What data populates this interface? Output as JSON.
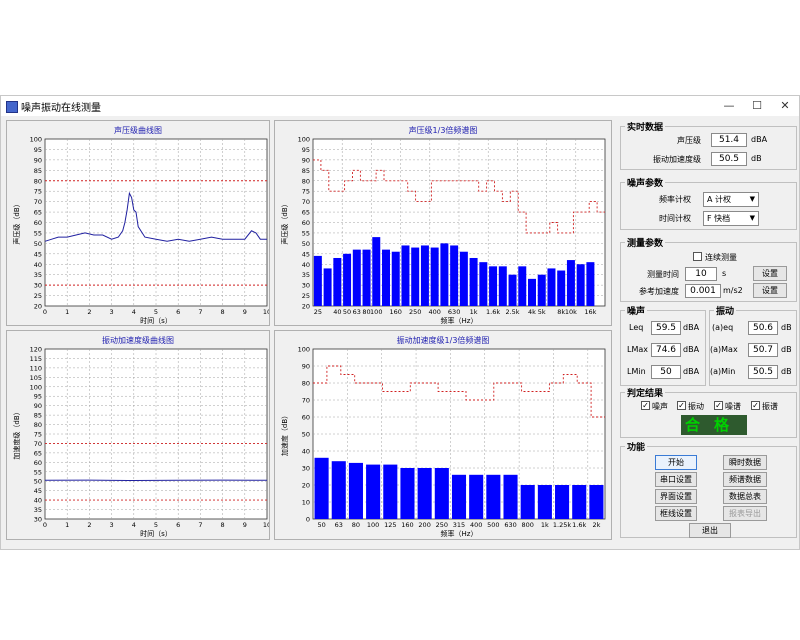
{
  "window": {
    "title": "噪声振动在线测量",
    "icon": "app-icon",
    "min": "—",
    "max": "☐",
    "close": "✕"
  },
  "charts": {
    "spl_curve": {
      "title": "声压级曲线图",
      "ylabel": "声压级（dB）",
      "xlabel": "时间（s）"
    },
    "spl_spectrum": {
      "title": "声压级1/3倍频谱图",
      "ylabel": "声压级（dB）",
      "xlabel": "频率（Hz）"
    },
    "acc_curve": {
      "title": "振动加速度级曲线图",
      "ylabel": "加速度级（dB）",
      "xlabel": "时间（s）"
    },
    "acc_spectrum": {
      "title": "振动加速度级1/3倍频谱图",
      "ylabel": "加速度（dB）",
      "xlabel": "频率（Hz）"
    }
  },
  "chart_data": [
    {
      "type": "line",
      "title": "声压级曲线图",
      "xlabel": "时间（s）",
      "ylabel": "声压级（dB）",
      "xlim": [
        0,
        10
      ],
      "ylim": [
        20,
        100
      ],
      "x_ticks": [
        0,
        1,
        2,
        3,
        4,
        5,
        6,
        7,
        8,
        9,
        10
      ],
      "y_ticks": [
        20,
        25,
        30,
        35,
        40,
        45,
        50,
        55,
        60,
        65,
        70,
        75,
        80,
        85,
        90,
        95,
        100
      ],
      "grid": true,
      "series": [
        {
          "color": "#2020a0",
          "x": [
            0,
            0.3,
            0.6,
            1,
            1.4,
            1.8,
            2.2,
            2.6,
            3,
            3.3,
            3.5,
            3.6,
            3.7,
            3.8,
            3.9,
            4.0,
            4.1,
            4.2,
            4.5,
            5,
            5.5,
            6,
            6.5,
            7,
            7.5,
            8,
            8.5,
            9,
            9.3,
            9.5,
            9.7,
            10
          ],
          "y": [
            51,
            52,
            53,
            53,
            54,
            55,
            54,
            54,
            52,
            53,
            56,
            60,
            66,
            74,
            72,
            66,
            65,
            58,
            53,
            52,
            51,
            52,
            51,
            52,
            53,
            52,
            52,
            52,
            56,
            55,
            52,
            52
          ]
        }
      ],
      "reference_lines": [
        {
          "y": 80,
          "color": "#d02020"
        },
        {
          "y": 30,
          "color": "#d02020"
        }
      ]
    },
    {
      "type": "bar",
      "title": "声压级1/3倍频谱图",
      "xlabel": "频率（Hz）",
      "ylabel": "声压级（dB）",
      "ylim": [
        20,
        100
      ],
      "y_ticks": [
        20,
        25,
        30,
        35,
        40,
        45,
        50,
        55,
        60,
        65,
        70,
        75,
        80,
        85,
        90,
        95,
        100
      ],
      "grid": true,
      "categories": [
        "25",
        "31.5",
        "40",
        "50",
        "63",
        "80",
        "100",
        "125",
        "160",
        "200",
        "250",
        "315",
        "400",
        "500",
        "630",
        "800",
        "1k",
        "1.25k",
        "1.6k",
        "2k",
        "2.5k",
        "3.15k",
        "4k",
        "5k",
        "6.3k",
        "8k",
        "10k",
        "12.5k",
        "16k",
        "20k"
      ],
      "tick_labels": [
        "25",
        "40",
        "50",
        "63",
        "80",
        "100",
        "160",
        "250",
        "400",
        "630",
        "1k",
        "1.6k",
        "2.5k",
        "4k",
        "5k",
        "8k",
        "10k",
        "16k"
      ],
      "values": [
        44,
        38,
        43,
        45,
        47,
        47,
        53,
        47,
        46,
        49,
        48,
        49,
        48,
        50,
        49,
        46,
        43,
        41,
        39,
        39,
        35,
        39,
        33,
        35,
        38,
        37,
        42,
        40,
        41
      ],
      "limit": {
        "color": "#d02020",
        "values": [
          90,
          85,
          75,
          75,
          80,
          85,
          80,
          80,
          85,
          80,
          80,
          80,
          75,
          70,
          70,
          80,
          80,
          80,
          80,
          80,
          80,
          75,
          80,
          75,
          70,
          75,
          65,
          55,
          55,
          55,
          60,
          55,
          55,
          65,
          65,
          70,
          65
        ]
      }
    },
    {
      "type": "line",
      "title": "振动加速度级曲线图",
      "xlabel": "时间（s）",
      "ylabel": "加速度级（dB）",
      "xlim": [
        0,
        10
      ],
      "ylim": [
        30,
        120
      ],
      "x_ticks": [
        0,
        1,
        2,
        3,
        4,
        5,
        6,
        7,
        8,
        9,
        10
      ],
      "y_ticks": [
        30,
        35,
        40,
        45,
        50,
        55,
        60,
        65,
        70,
        75,
        80,
        85,
        90,
        95,
        100,
        105,
        110,
        115,
        120
      ],
      "grid": true,
      "series": [
        {
          "color": "#2020a0",
          "x": [
            0,
            2,
            4,
            6,
            8,
            10
          ],
          "y": [
            50.5,
            50.6,
            50.4,
            50.5,
            50.6,
            50.5
          ]
        }
      ],
      "reference_lines": [
        {
          "y": 70,
          "color": "#d02020"
        },
        {
          "y": 40,
          "color": "#d02020"
        }
      ]
    },
    {
      "type": "bar",
      "title": "振动加速度级1/3倍频谱图",
      "xlabel": "频率（Hz）",
      "ylabel": "加速度（dB）",
      "ylim": [
        0,
        100
      ],
      "y_ticks": [
        0,
        10,
        20,
        30,
        40,
        50,
        60,
        70,
        80,
        90,
        100
      ],
      "grid": true,
      "categories": [
        "50",
        "63",
        "80",
        "100",
        "125",
        "160",
        "200",
        "250",
        "315",
        "400",
        "500",
        "630",
        "800",
        "1k",
        "1.25k",
        "1.6k",
        "2k"
      ],
      "values": [
        36,
        34,
        33,
        32,
        32,
        30,
        30,
        30,
        26,
        26,
        26,
        26,
        20,
        20,
        20,
        20,
        20
      ],
      "limit": {
        "color": "#d02020",
        "values": [
          80,
          90,
          85,
          80,
          80,
          75,
          75,
          80,
          80,
          75,
          75,
          70,
          70,
          80,
          80,
          75,
          75,
          80,
          85,
          80,
          60
        ]
      }
    }
  ],
  "realtime": {
    "title": "实时数据",
    "spl_label": "声压级",
    "spl_value": "51.4",
    "spl_unit": "dBA",
    "acc_label": "振动加速度级",
    "acc_value": "50.5",
    "acc_unit": "dB"
  },
  "noise_params": {
    "title": "噪声参数",
    "freq_label": "频率计权",
    "freq_value": "A 计权",
    "time_label": "时间计权",
    "time_value": "F 快档"
  },
  "measure_params": {
    "title": "测量参数",
    "continuous_label": "连续测量",
    "time_label": "测量时间",
    "time_value": "10",
    "time_unit": "s",
    "ref_label": "参考加速度",
    "ref_value": "0.001",
    "ref_unit": "m/s2",
    "set_label": "设置"
  },
  "noise_stats": {
    "title": "噪声",
    "leq_label": "Leq",
    "leq_value": "59.5",
    "lmax_label": "LMax",
    "lmax_value": "74.6",
    "lmin_label": "LMin",
    "lmin_value": "50",
    "unit": "dBA"
  },
  "vib_stats": {
    "title": "振动",
    "eq_label": "(a)eq",
    "eq_value": "50.6",
    "max_label": "(a)Max",
    "max_value": "50.7",
    "min_label": "(a)Min",
    "min_value": "50.5",
    "unit": "dB"
  },
  "verdict": {
    "title": "判定结果",
    "checks": [
      "噪声",
      "振动",
      "噪谱",
      "振谱"
    ],
    "result": "合格",
    "result_color": "#00d000"
  },
  "functions": {
    "title": "功能",
    "start": "开始",
    "instant": "瞬时数据",
    "serial": "串口设置",
    "spectrum": "频谱数据",
    "ui": "界面设置",
    "summary": "数据总表",
    "axis": "框线设置",
    "export": "报表导出",
    "exit": "退出"
  }
}
